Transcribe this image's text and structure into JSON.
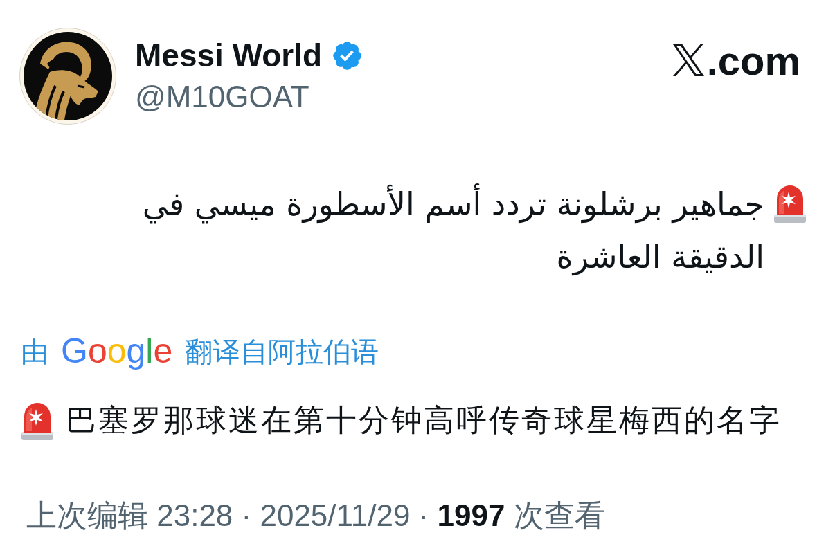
{
  "author": {
    "name": "Messi World",
    "verified": true,
    "handle": "@M10GOAT"
  },
  "brand": {
    "text": ".com"
  },
  "tweet": {
    "text": "جماهير برشلونة تردد أسم الأسطورة ميسي في الدقيقة العاشرة"
  },
  "translation": {
    "prefix": "由",
    "provider": "Google",
    "suffix": "翻译自阿拉伯语",
    "text": "巴塞罗那球迷在第十分钟高呼传奇球星梅西的名字"
  },
  "meta": {
    "text": "上次编辑 23:28 · 2025/11/29 · **1997** 次查看"
  }
}
